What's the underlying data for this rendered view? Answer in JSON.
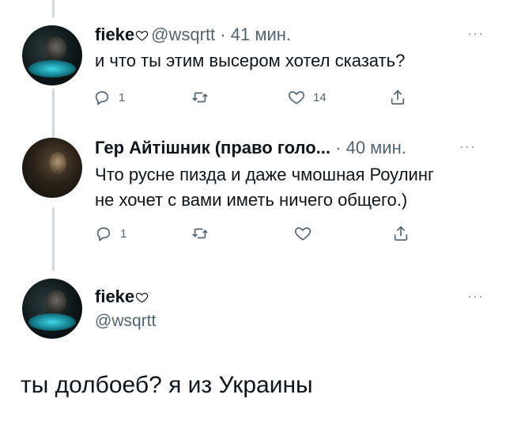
{
  "tweets": [
    {
      "name": "fieke",
      "handle": "@wsqrtt",
      "time": "· 41 мин.",
      "text": "и что ты этим высером хотел сказать?",
      "reply_count": "1",
      "retweet_count": "",
      "like_count": "14",
      "more": "···"
    },
    {
      "name": "Гер Айтішник (право голо...",
      "handle": "",
      "time": "· 40 мин.",
      "text_line1": "Что русне пизда и даже чмошная Роулинг",
      "text_line2": "не хочет с вами иметь ничего общего.)",
      "reply_count": "1",
      "retweet_count": "",
      "like_count": "",
      "more": "···"
    },
    {
      "name": "fieke",
      "handle": "@wsqrtt",
      "text": "ты долбоеб? я из Украины",
      "more": "···"
    }
  ]
}
